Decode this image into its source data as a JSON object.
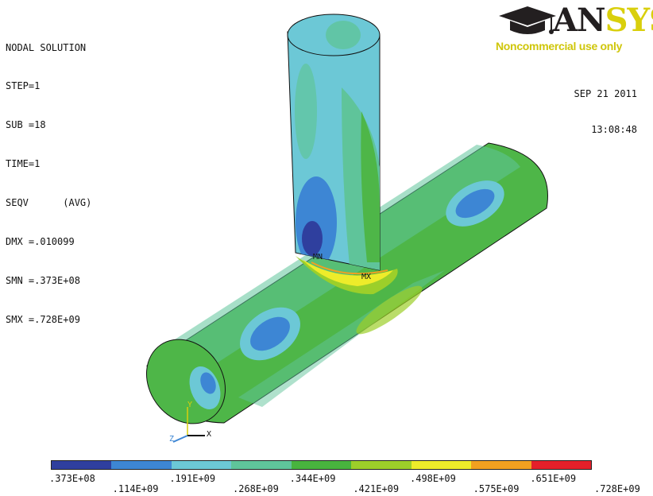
{
  "header": {
    "solution_title": "NODAL SOLUTION",
    "lines": [
      "STEP=1",
      "SUB =18",
      "TIME=1",
      "SEQV      (AVG)",
      "DMX =.010099",
      "SMN =.373E+08",
      "SMX =.728E+09"
    ]
  },
  "timestamp": {
    "date": "SEP 21 2011",
    "time": "13:08:48"
  },
  "logo": {
    "word_dark": "AN",
    "word_accent": "SYS",
    "tagline": "Noncommercial use only",
    "icon": "graduation-cap-icon"
  },
  "markers": {
    "min_label": "MN",
    "max_label": "MX"
  },
  "triad": {
    "x_label": "X",
    "y_label": "Y",
    "z_label": "Z"
  },
  "legend": {
    "colors": [
      "#2f3f9e",
      "#3d86d4",
      "#6cc8d6",
      "#5fc49a",
      "#48b43e",
      "#9ccf2a",
      "#eeec2a",
      "#f2a020",
      "#e4202a"
    ],
    "top_labels": [
      ".373E+08",
      ".191E+09",
      ".344E+09",
      ".498E+09",
      ".651E+09"
    ],
    "bottom_labels": [
      ".114E+09",
      ".268E+09",
      ".421E+09",
      ".575E+09",
      ".728E+09"
    ]
  }
}
